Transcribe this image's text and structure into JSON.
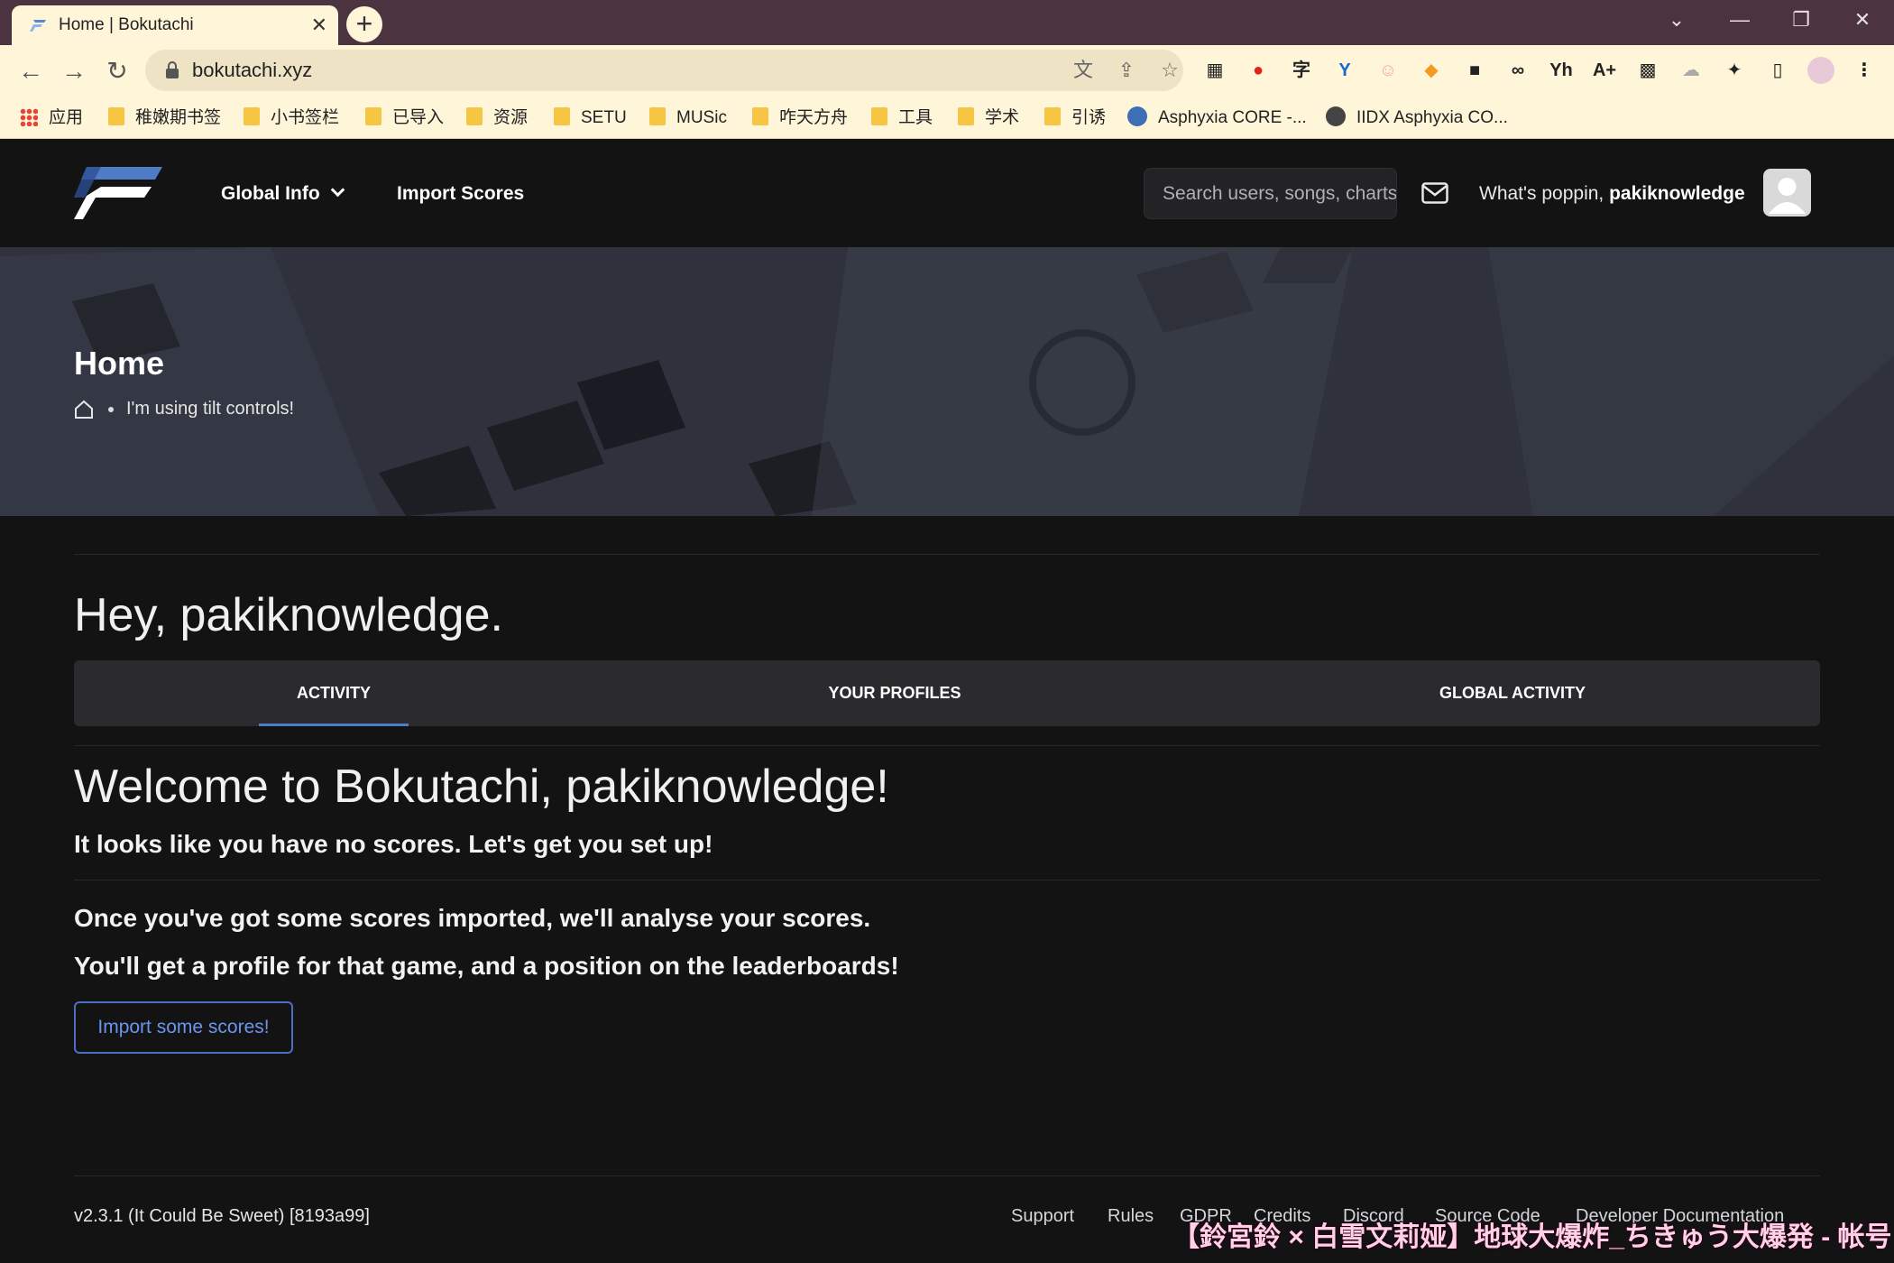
{
  "browser": {
    "tab_title": "Home | Bokutachi",
    "tab_close": "✕",
    "new_tab": "+",
    "url": "bokutachi.xyz",
    "window_controls": [
      "⌄",
      "—",
      "❐",
      "✕"
    ],
    "bookmarks": [
      {
        "label": "应用",
        "icon": "apps-grid-icon"
      },
      {
        "label": "稚嫩期书签",
        "icon": "folder-icon"
      },
      {
        "label": "小书签栏",
        "icon": "folder-icon"
      },
      {
        "label": "已导入",
        "icon": "folder-icon"
      },
      {
        "label": "资源",
        "icon": "folder-icon"
      },
      {
        "label": "SETU",
        "icon": "folder-icon"
      },
      {
        "label": "MUSic",
        "icon": "folder-icon"
      },
      {
        "label": "咋天方舟",
        "icon": "folder-icon"
      },
      {
        "label": "工具",
        "icon": "folder-icon"
      },
      {
        "label": "学术",
        "icon": "folder-icon"
      },
      {
        "label": "引诱",
        "icon": "folder-icon"
      },
      {
        "label": "Asphyxia CORE -...",
        "icon": "globe-icon"
      },
      {
        "label": "IIDX Asphyxia CO...",
        "icon": "globe-icon"
      }
    ]
  },
  "nav": {
    "global_info": "Global Info",
    "import_scores": "Import Scores",
    "search_placeholder": "Search users, songs, charts...",
    "greeting_prefix": "What's poppin, ",
    "username": "pakiknowledge"
  },
  "hero": {
    "title": "Home",
    "crumb": "I'm using tilt controls!"
  },
  "main": {
    "hey": "Hey, pakiknowledge.",
    "tabs": [
      "ACTIVITY",
      "YOUR PROFILES",
      "GLOBAL ACTIVITY"
    ],
    "welcome": "Welcome to Bokutachi, pakiknowledge!",
    "no_scores": "It looks like you have no scores. Let's get you set up!",
    "line1": "Once you've got some scores imported, we'll analyse your scores.",
    "line2": "You'll get a profile for that game, and a position on the leaderboards!",
    "import_button": "Import some scores!"
  },
  "footer": {
    "version": "v2.3.1 (It Could Be Sweet) [8193a99]",
    "links": [
      "Support",
      "Rules",
      "GDPR",
      "Credits",
      "Discord",
      "Source Code",
      "Developer Documentation"
    ]
  },
  "overlay_text": "【鈴宮鈴 × 白雪文莉娅】地球大爆炸_ちきゅう大爆発 - 帐号",
  "colors": {
    "accent": "#4a6fc4",
    "background": "#131314"
  }
}
